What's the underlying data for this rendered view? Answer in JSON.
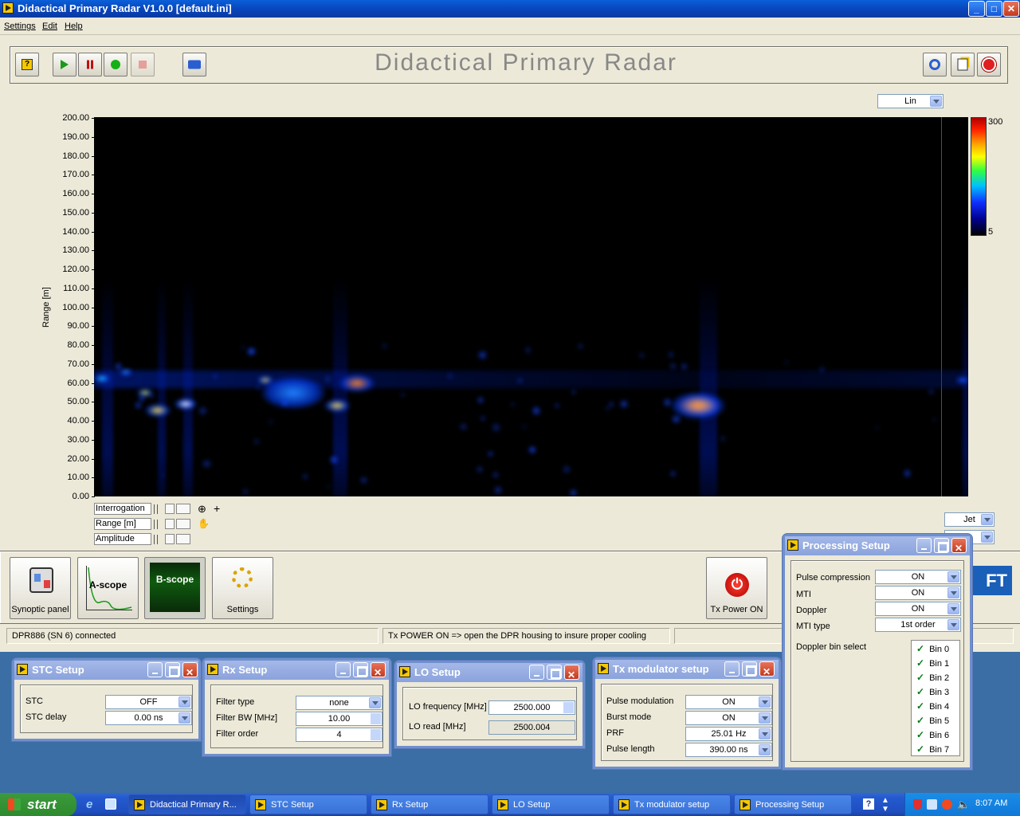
{
  "window": {
    "title": "Didactical Primary Radar V1.0.0  [default.ini]"
  },
  "menu": [
    "Settings",
    "Edit",
    "Help"
  ],
  "header": {
    "title": "Didactical Primary Radar"
  },
  "scale_select": "Lin",
  "chart_data": {
    "type": "heatmap",
    "ylabel": "Range [m]",
    "ylim": [
      0,
      200
    ],
    "yticks": [
      "200.00",
      "190.00",
      "180.00",
      "170.00",
      "160.00",
      "150.00",
      "140.00",
      "130.00",
      "120.00",
      "110.00",
      "100.00",
      "90.00",
      "80.00",
      "70.00",
      "60.00",
      "50.00",
      "40.00",
      "30.00",
      "20.00",
      "10.00",
      "0.00"
    ],
    "colorbar": {
      "max_label": "300",
      "min_label": "5",
      "colormap": "Jet"
    }
  },
  "cursor_legend": [
    "Interrogation",
    "Range [m]",
    "Amplitude"
  ],
  "colormap_select": "Jet",
  "modules": {
    "synoptic": "Synoptic panel",
    "ascope": "A-scope",
    "bscope": "B-scope",
    "settings": "Settings",
    "txpower": "Tx Power ON"
  },
  "status": {
    "left": "DPR886 (SN 6) connected",
    "middle": "Tx POWER ON => open the DPR housing to insure proper cooling"
  },
  "stc": {
    "title": "STC Setup",
    "stc_label": "STC",
    "stc_value": "OFF",
    "delay_label": "STC delay",
    "delay_value": "0.00 ns"
  },
  "rx": {
    "title": "Rx Setup",
    "type_label": "Filter type",
    "type_value": "none",
    "bw_label": "Filter BW [MHz]",
    "bw_value": "10.00",
    "order_label": "Filter order",
    "order_value": "4"
  },
  "lo": {
    "title": "LO Setup",
    "freq_label": "LO frequency [MHz]",
    "freq_value": "2500.000",
    "read_label": "LO read [MHz]",
    "read_value": "2500.004"
  },
  "tx": {
    "title": "Tx modulator setup",
    "pm_label": "Pulse modulation",
    "pm_value": "ON",
    "burst_label": "Burst mode",
    "burst_value": "ON",
    "prf_label": "PRF",
    "prf_value": "25.01 Hz",
    "pl_label": "Pulse length",
    "pl_value": "390.00 ns"
  },
  "proc": {
    "title": "Processing Setup",
    "pc_label": "Pulse compression",
    "pc_value": "ON",
    "mti_label": "MTI",
    "mti_value": "ON",
    "dop_label": "Doppler",
    "dop_value": "ON",
    "mtitype_label": "MTI type",
    "mtitype_value": "1st order",
    "bins_label": "Doppler bin select",
    "bins": [
      "Bin 0",
      "Bin 1",
      "Bin 2",
      "Bin 3",
      "Bin 4",
      "Bin 5",
      "Bin 6",
      "Bin 7"
    ]
  },
  "taskbar": {
    "start": "start",
    "tasks": [
      "Didactical Primary R...",
      "STC Setup",
      "Rx Setup",
      "LO Setup",
      "Tx modulator setup",
      "Processing Setup"
    ],
    "clock": "8:07 AM"
  }
}
